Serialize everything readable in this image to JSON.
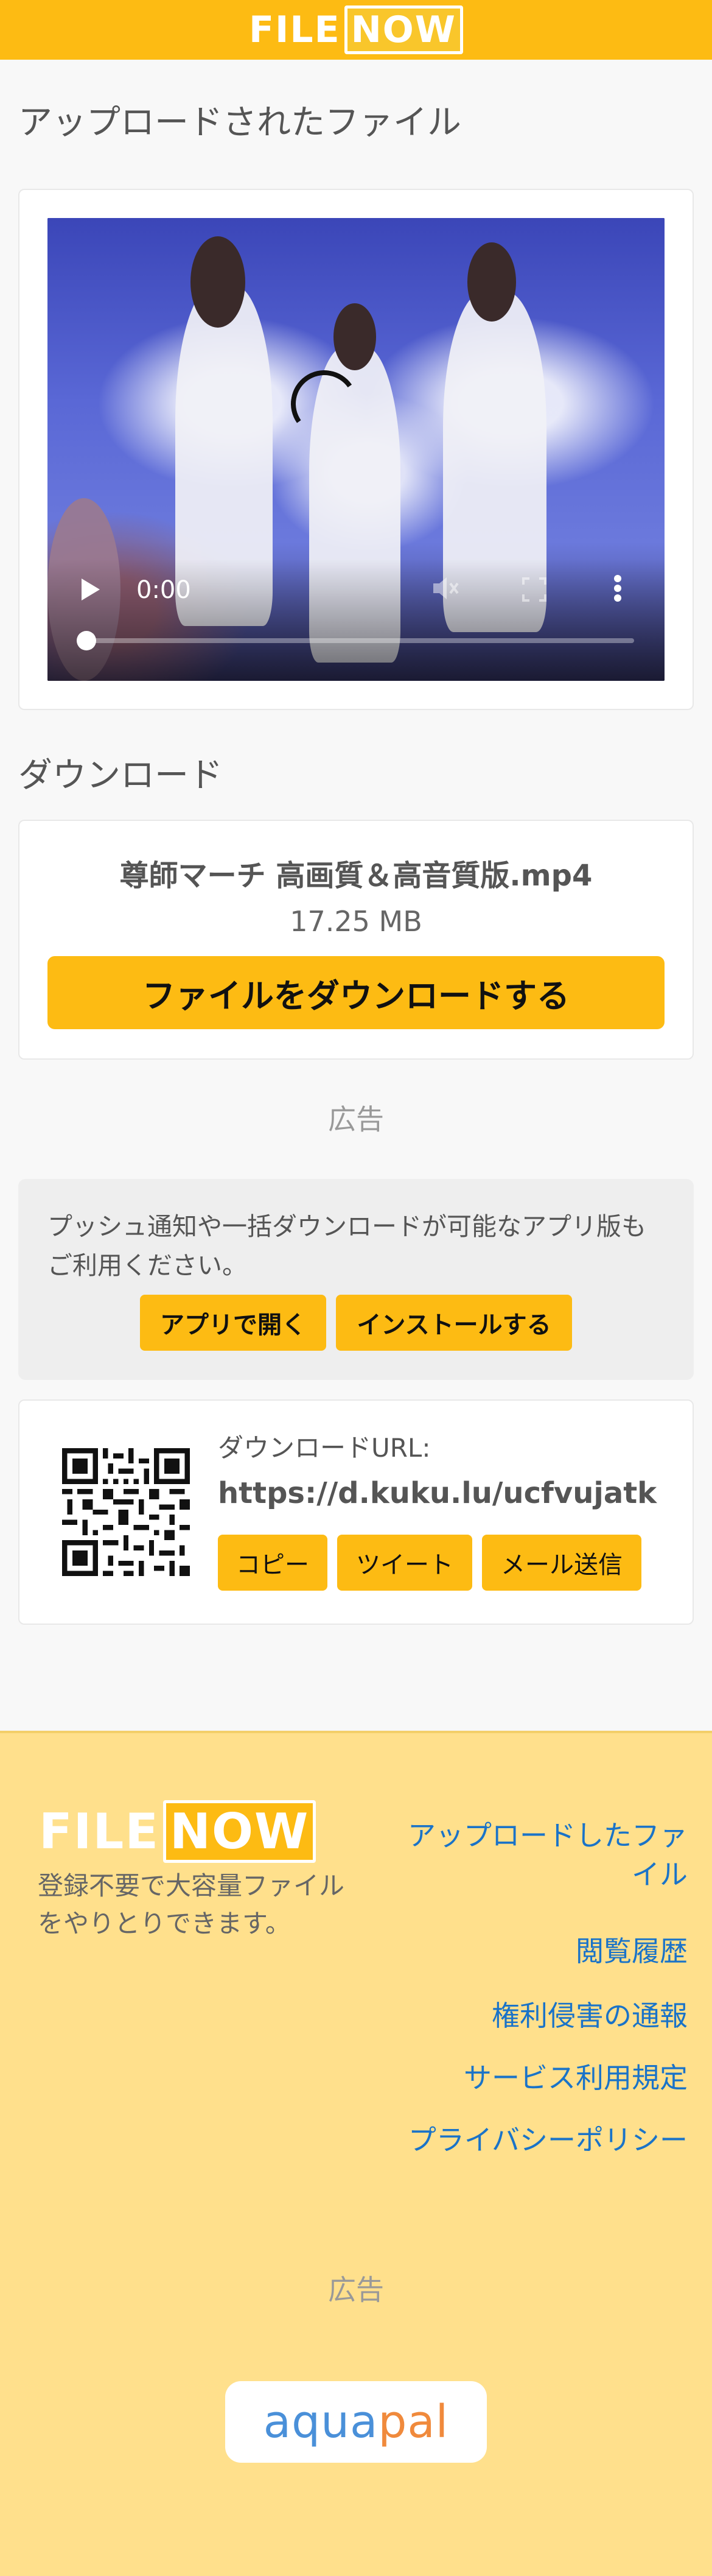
{
  "header": {
    "logo_part1": "FILE",
    "logo_part2": "NOW"
  },
  "uploaded": {
    "heading": "アップロードされたファイル"
  },
  "video": {
    "time": "0:00",
    "progress": 0
  },
  "download": {
    "heading": "ダウンロード",
    "filename": "尊師マーチ 高画質＆高音質版.mp4",
    "filesize": "17.25 MB",
    "button": "ファイルをダウンロードする"
  },
  "ad_label_top": "広告",
  "app_promo": {
    "text": "プッシュ通知や一括ダウンロードが可能なアプリ版もご利用ください。",
    "open_button": "アプリで開く",
    "install_button": "インストールする"
  },
  "share": {
    "url_label": "ダウンロードURL:",
    "url": "https://d.kuku.lu/ucfvujatk",
    "copy": "コピー",
    "tweet": "ツイート",
    "mail": "メール送信"
  },
  "footer": {
    "logo_part1": "FILE",
    "logo_part2": "NOW",
    "tagline": "登録不要で大容量ファイルをやりとりできます。",
    "links": [
      "アップロードしたファイル",
      "閲覧履歴",
      "権利侵害の通報",
      "サービス利用規定",
      "プライバシーポリシー"
    ],
    "ad_label": "広告",
    "sponsor_part1": "aqua",
    "sponsor_part2": "pal"
  },
  "colors": {
    "brand_yellow": "#fdbb13",
    "footer_bg": "#ffe08c",
    "link_blue": "#1a73c8"
  }
}
